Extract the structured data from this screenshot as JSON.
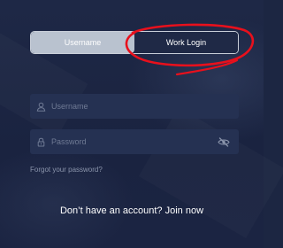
{
  "login_toggle": {
    "username_tab": "Username",
    "work_login_tab": "Work Login",
    "selected": "Username"
  },
  "form": {
    "username_placeholder": "Username",
    "password_placeholder": "Password",
    "username_icon": "user-icon",
    "password_icon": "lock-icon",
    "visibility_icon": "eye-slash-icon"
  },
  "links": {
    "forgot_password": "Forgot your password?",
    "join_now": "Don’t have an account? Join now"
  },
  "colors": {
    "background": "#1c2642",
    "field_background": "#253152",
    "toggle_active": "#b9c2cf",
    "annotation_red": "#e8101c"
  }
}
